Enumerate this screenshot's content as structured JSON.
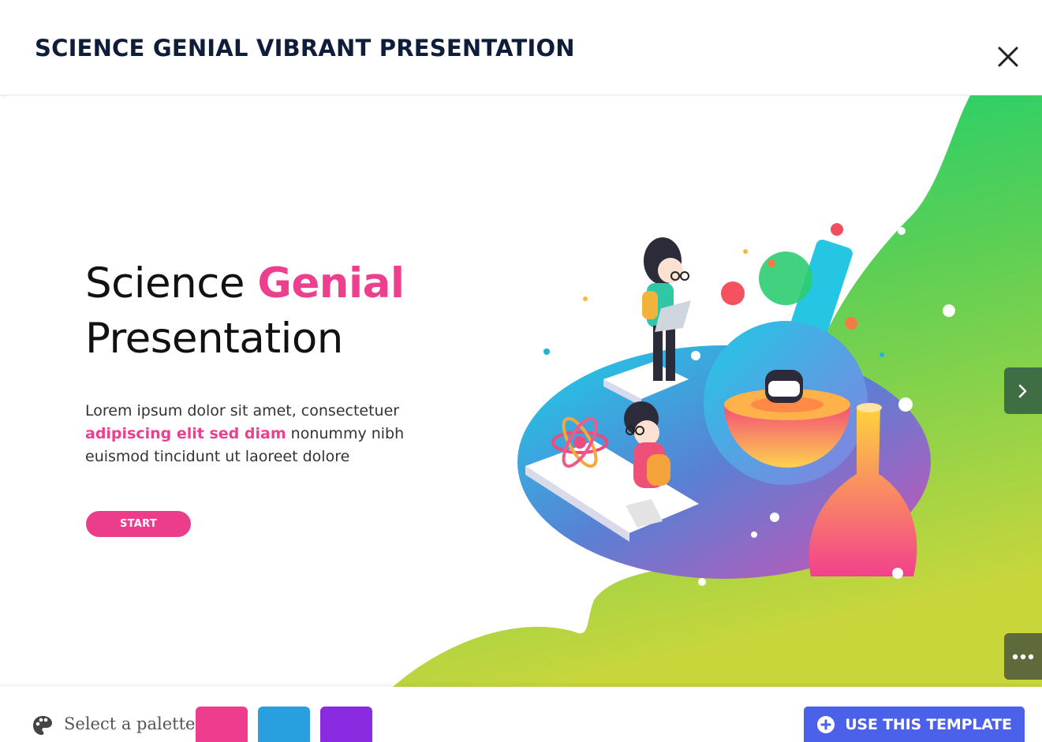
{
  "modal": {
    "title": "SCIENCE GENIAL VIBRANT PRESENTATION",
    "close_icon": "close-icon"
  },
  "slide": {
    "title_part1": "Science ",
    "title_accent": "Genial",
    "title_part2": "Presentation",
    "body_part1": "Lorem ipsum dolor sit amet, consectetuer ",
    "body_accent": "adipiscing elit sed diam",
    "body_part2": " nonummy nibh euismod tincidunt ut laoreet dolore",
    "start_label": "START"
  },
  "side_controls": {
    "next_icon": "chevron-right-icon",
    "more_icon": "ellipsis-icon"
  },
  "footer": {
    "palette_icon": "palette-icon",
    "palette_label": "Select a palette",
    "swatches": [
      {
        "name": "pink",
        "color": "#ee3d8f"
      },
      {
        "name": "blue",
        "color": "#2a9fe0"
      },
      {
        "name": "purple",
        "color": "#8a2be2"
      }
    ],
    "use_template_label": "USE THIS TEMPLATE",
    "use_template_icon": "plus-circle-icon"
  },
  "colors": {
    "accent": "#ee3f8f",
    "primary_button": "#4b61ea",
    "title_text": "#0f1d3a"
  }
}
